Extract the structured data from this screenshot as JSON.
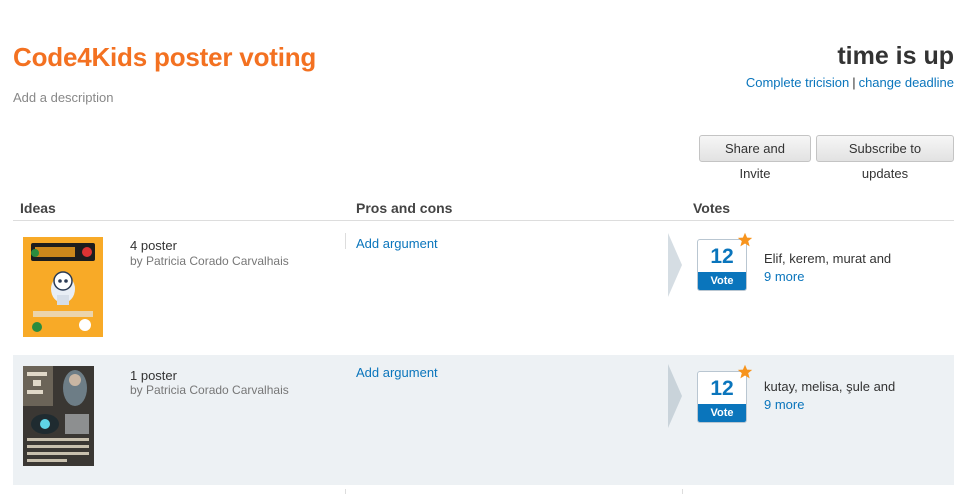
{
  "header": {
    "title": "Code4Kids poster voting",
    "description": "Add a description",
    "status": "time is up",
    "complete_link": "Complete tricision",
    "separator": "|",
    "deadline_link": "change deadline"
  },
  "toolbar": {
    "share_label": "Share and Invite",
    "subscribe_label": "Subscribe to updates"
  },
  "table": {
    "columns": [
      "Ideas",
      "Pros and cons",
      "Votes"
    ],
    "rows": [
      {
        "idea": "4 poster",
        "author": "by Patricia Corado Carvalhais",
        "add_argument": "Add argument",
        "votes": "12",
        "vote_label": "Vote",
        "voters": "Elif, kerem, murat and",
        "more": "9 more"
      },
      {
        "idea": "1 poster",
        "author": "by Patricia Corado Carvalhais",
        "add_argument": "Add argument",
        "votes": "12",
        "vote_label": "Vote",
        "voters": "kutay, melisa, şule and",
        "more": "9 more"
      }
    ]
  },
  "colors": {
    "accent": "#f37121",
    "link": "#0a75bc",
    "row_alt": "#edf1f4"
  },
  "icons": {
    "star": "star-icon",
    "arrow": "chevron-right-icon"
  }
}
